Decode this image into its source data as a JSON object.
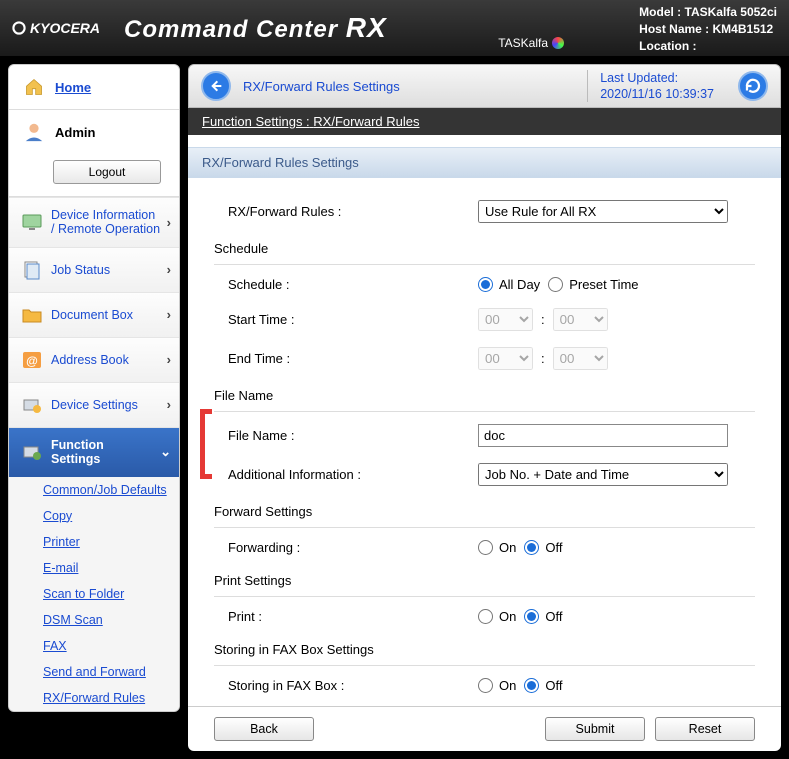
{
  "brand": "KYOCERA",
  "product_title": "Command Center",
  "product_title_suffix": "RX",
  "sub_brand": "TASKalfa",
  "device": {
    "model_label": "Model :",
    "model": "TASKalfa 5052ci",
    "host_label": "Host Name :",
    "host": "KM4B1512",
    "location_label": "Location :",
    "location": ""
  },
  "home": "Home",
  "user": "Admin",
  "logout": "Logout",
  "nav": {
    "device_info": "Device Information / Remote Operation",
    "job_status": "Job Status",
    "doc_box": "Document Box",
    "addr_book": "Address Book",
    "dev_settings": "Device Settings",
    "func_settings": "Function Settings"
  },
  "sub": {
    "common": "Common/Job Defaults",
    "copy": "Copy",
    "printer": "Printer",
    "email": "E-mail",
    "scan_folder": "Scan to Folder",
    "dsm": "DSM Scan",
    "fax": "FAX",
    "send_fwd": "Send and Forward",
    "rx_rules": "RX/Forward Rules"
  },
  "crumb": {
    "title": "RX/Forward Rules Settings",
    "last_upd_label": "Last Updated:",
    "last_upd": "2020/11/16 10:39:37"
  },
  "bc2_a": "Function Settings :",
  "bc2_b": "RX/Forward Rules",
  "section_title": "RX/Forward Rules Settings",
  "form": {
    "rules_label": "RX/Forward Rules :",
    "rules_value": "Use Rule for All RX",
    "schedule_h": "Schedule",
    "schedule_label": "Schedule :",
    "allday": "All Day",
    "preset": "Preset Time",
    "start": "Start Time :",
    "end": "End Time :",
    "hh": "00",
    "mm": "00",
    "file_h": "File Name",
    "file_label": "File Name :",
    "file_value": "doc",
    "addl_label": "Additional Information :",
    "addl_value": "Job No. + Date and Time",
    "fwd_h": "Forward Settings",
    "fwd_label": "Forwarding :",
    "print_h": "Print Settings",
    "print_label": "Print :",
    "faxbox_h": "Storing in FAX Box Settings",
    "faxbox_label": "Storing in FAX Box :",
    "on": "On",
    "off": "Off"
  },
  "btn": {
    "back": "Back",
    "submit": "Submit",
    "reset": "Reset"
  }
}
